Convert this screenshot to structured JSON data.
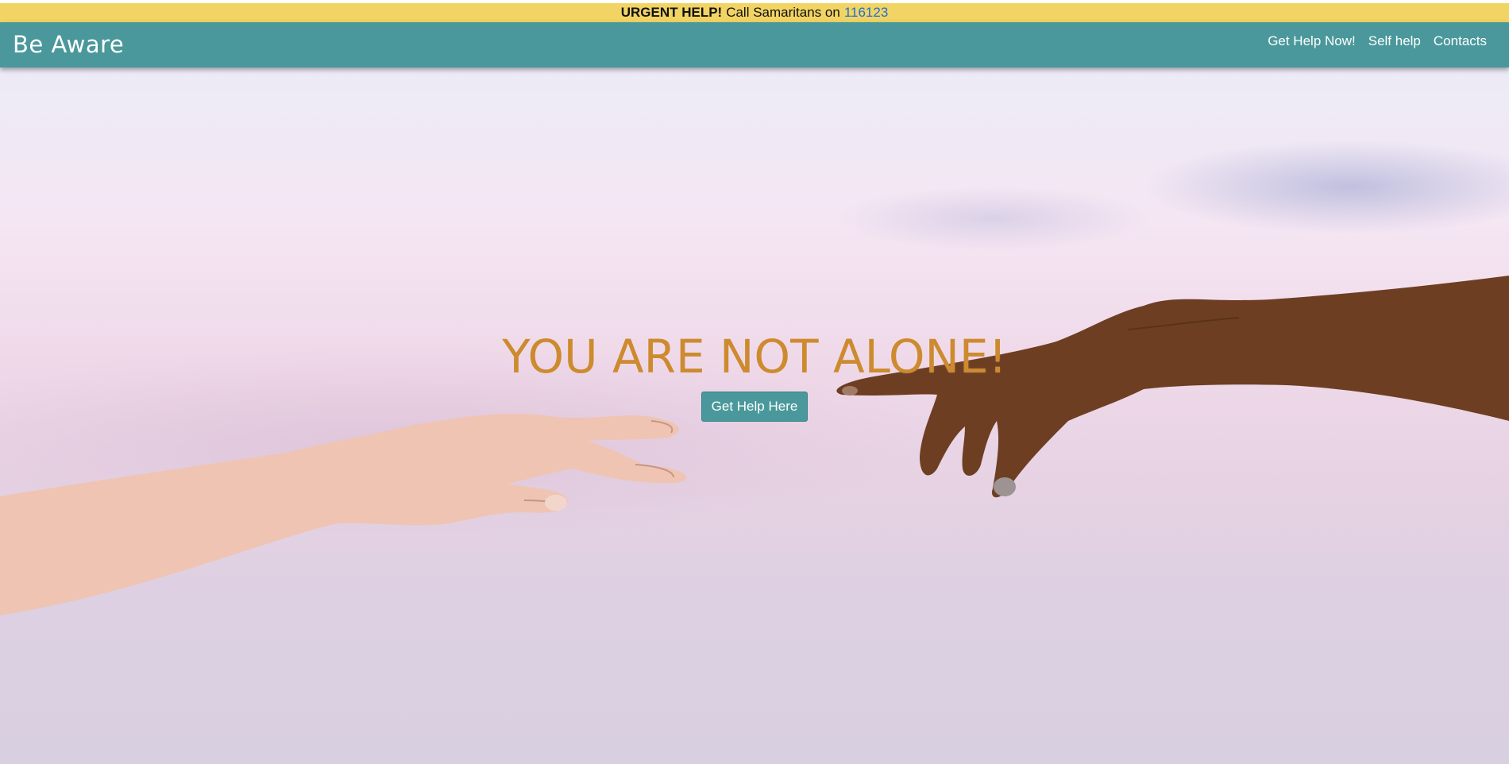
{
  "urgent": {
    "label": "URGENT HELP!",
    "text": "Call Samaritans on",
    "phone": "116123"
  },
  "navbar": {
    "brand": "Be Aware",
    "links": [
      "Get Help Now!",
      "Self help",
      "Contacts"
    ]
  },
  "hero": {
    "title": "YOU ARE NOT ALONE!",
    "button_label": "Get Help Here",
    "background_image": "two-hands-reaching-toward-each-other-against-pastel-sky"
  },
  "colors": {
    "urgent_bar": "#f2d464",
    "navbar": "#4a989b",
    "title": "#cd8a2f",
    "phone_link": "#1f6fd1"
  }
}
